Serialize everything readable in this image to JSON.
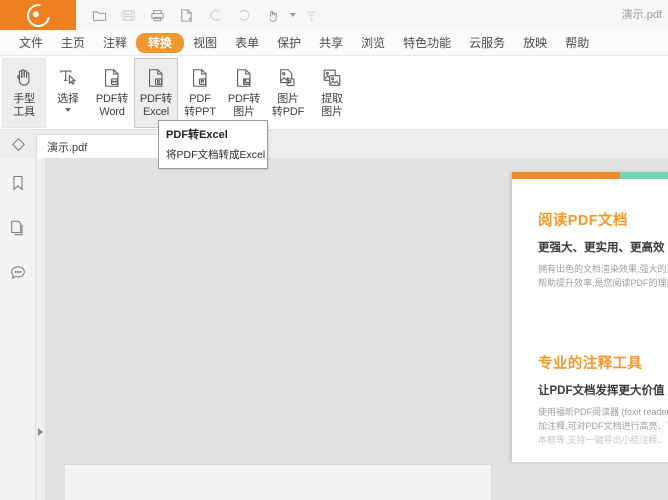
{
  "app": {
    "logo_icon": "foxit-logo-icon",
    "document_title": "演示.pdf"
  },
  "quick_access": {
    "buttons": [
      {
        "name": "open-file-button",
        "icon": "folder-open-icon",
        "disabled": false
      },
      {
        "name": "save-button",
        "icon": "save-floppy-icon",
        "disabled": true
      },
      {
        "name": "print-button",
        "icon": "printer-icon",
        "disabled": false
      },
      {
        "name": "create-pdf-button",
        "icon": "new-page-icon",
        "disabled": false
      },
      {
        "name": "undo-button",
        "icon": "undo-arrow-icon",
        "disabled": true
      },
      {
        "name": "redo-button",
        "icon": "redo-arrow-icon",
        "disabled": true
      },
      {
        "name": "touch-mode-button",
        "icon": "hand-touch-icon",
        "disabled": false
      }
    ],
    "overflow_icon": "customize-toolbar-icon"
  },
  "menubar": {
    "items": [
      {
        "label": "文件",
        "active": false
      },
      {
        "label": "主页",
        "active": false
      },
      {
        "label": "注释",
        "active": false
      },
      {
        "label": "转换",
        "active": true
      },
      {
        "label": "视图",
        "active": false
      },
      {
        "label": "表单",
        "active": false
      },
      {
        "label": "保护",
        "active": false
      },
      {
        "label": "共享",
        "active": false
      },
      {
        "label": "浏览",
        "active": false
      },
      {
        "label": "特色功能",
        "active": false
      },
      {
        "label": "云服务",
        "active": false
      },
      {
        "label": "放映",
        "active": false
      },
      {
        "label": "帮助",
        "active": false
      }
    ],
    "accent_color": "#f0982f"
  },
  "ribbon": {
    "items": [
      {
        "name": "hand-tool-button",
        "icon": "hand-icon",
        "line1": "手型",
        "line2": "工具",
        "state": "selected",
        "has_caret": false
      },
      {
        "name": "select-tool-button",
        "icon": "text-select-icon",
        "line1": "选择",
        "line2": "",
        "state": "normal",
        "has_caret": true
      },
      {
        "name": "pdf-to-word-button",
        "icon": "doc-word-icon",
        "line1": "PDF转",
        "line2": "Word",
        "state": "normal",
        "has_caret": false
      },
      {
        "name": "pdf-to-excel-button",
        "icon": "doc-excel-icon",
        "line1": "PDF转",
        "line2": "Excel",
        "state": "hovered",
        "has_caret": false
      },
      {
        "name": "pdf-to-ppt-button",
        "icon": "doc-ppt-icon",
        "line1": "PDF",
        "line2": "转PPT",
        "state": "normal",
        "has_caret": false
      },
      {
        "name": "pdf-to-image-button",
        "icon": "doc-image-icon",
        "line1": "PDF转",
        "line2": "图片",
        "state": "normal",
        "has_caret": false
      },
      {
        "name": "image-to-pdf-button",
        "icon": "image-to-pdf-icon",
        "line1": "图片",
        "line2": "转PDF",
        "state": "normal",
        "has_caret": false
      },
      {
        "name": "extract-image-button",
        "icon": "extract-image-icon",
        "line1": "提取",
        "line2": "图片",
        "state": "normal",
        "has_caret": false
      }
    ]
  },
  "tooltip": {
    "title": "PDF转Excel",
    "description": "将PDF文档转成Excel"
  },
  "tabrow": {
    "left_icon": "eraser-icon",
    "tabs": [
      {
        "label": "演示.pdf",
        "active": true
      }
    ]
  },
  "rail": {
    "items": [
      {
        "name": "sidebar-item-bookmarks",
        "icon": "bookmark-icon"
      },
      {
        "name": "sidebar-item-pages",
        "icon": "pages-icon"
      },
      {
        "name": "sidebar-item-comments",
        "icon": "comment-bubble-icon"
      }
    ],
    "expand_icon": "chevron-right-icon"
  },
  "document": {
    "header_bar": {
      "left_color": "#ef8a28",
      "right_color": "#6ed7b0"
    },
    "sections": [
      {
        "heading": "阅读PDF文档",
        "subheading": "更强大、更实用、更高效",
        "paragraphs": [
          "拥有出色的文档渲染效果,强大的页",
          "帮助提升效率,是您阅读PDF的理想"
        ],
        "faded_paragraphs": []
      },
      {
        "heading": "专业的注释工具",
        "subheading": "让PDF文档发挥更大价值",
        "paragraphs": [
          "使用福昕PDF阅读器 (foxit reader)",
          "加注释,可对PDF文档进行高亮、下划"
        ],
        "faded_paragraphs": [
          "本框等,支持一键导出小结注释。"
        ]
      }
    ]
  }
}
